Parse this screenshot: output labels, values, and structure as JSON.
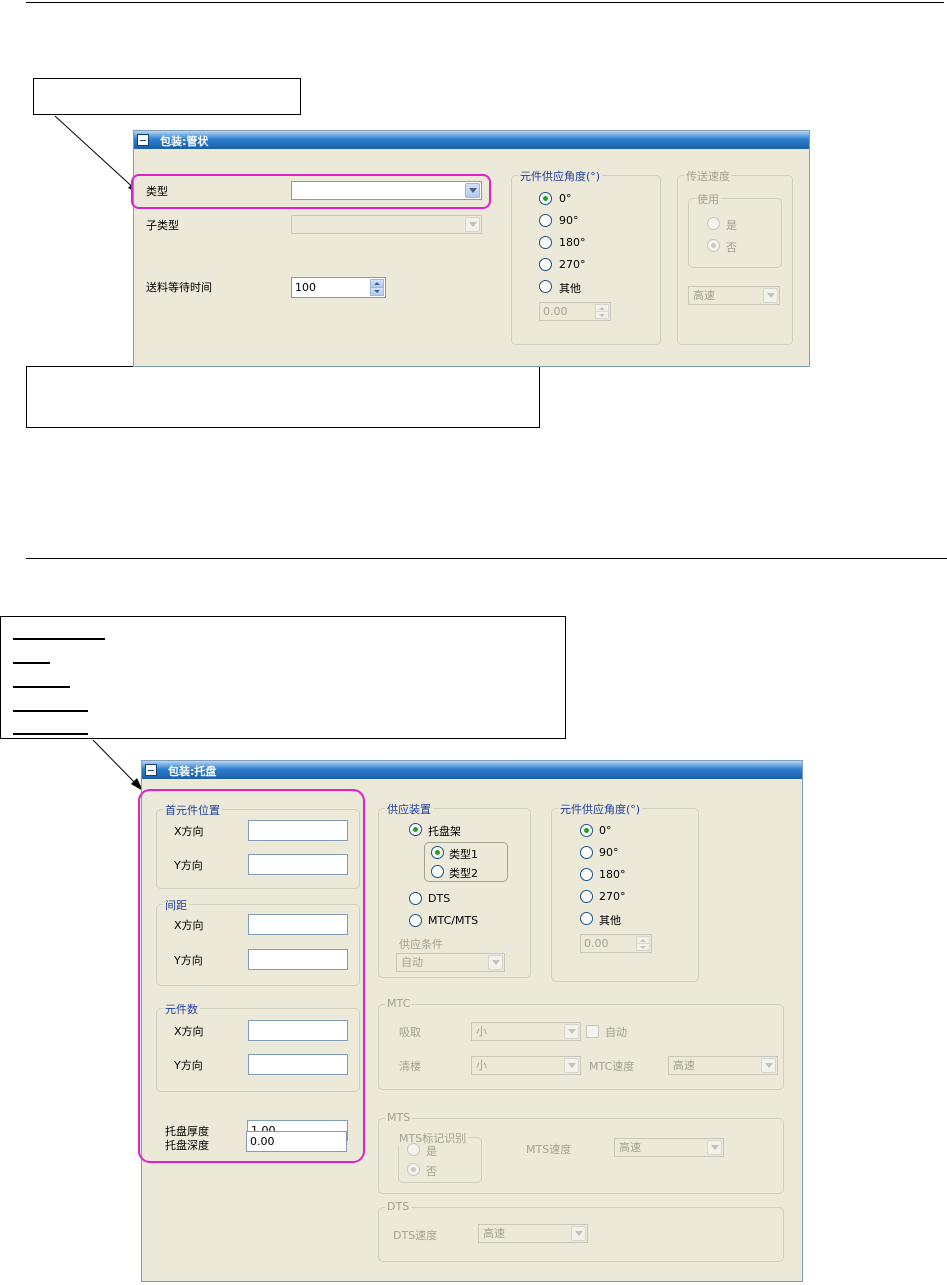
{
  "tube_panel": {
    "title": "包装:管状",
    "type_label": "类型",
    "type_value": "",
    "subtype_label": "子类型",
    "subtype_value": "",
    "feed_wait_label": "送料等待时间",
    "feed_wait_value": "100",
    "angle_group": {
      "legend": "元件供应角度(°)",
      "options": [
        "0°",
        "90°",
        "180°",
        "270°",
        "其他"
      ],
      "selected": "0°",
      "other_value": "0.00"
    },
    "speed_group": {
      "legend": "传送速度",
      "use_legend": "使用",
      "options": [
        "是",
        "否"
      ],
      "selected": "否",
      "speed_value": "高速"
    }
  },
  "tray_panel": {
    "title": "包装:托盘",
    "first_pos": {
      "legend": "首元件位置",
      "x_label": "X方向",
      "y_label": "Y方向",
      "x_value": "",
      "y_value": ""
    },
    "pitch": {
      "legend": "间距",
      "x_label": "X方向",
      "y_label": "Y方向",
      "x_value": "",
      "y_value": ""
    },
    "count": {
      "legend": "元件数",
      "x_label": "X方向",
      "y_label": "Y方向",
      "x_value": "",
      "y_value": ""
    },
    "thickness_label": "托盘厚度",
    "thickness_value": "1.00",
    "depth_label": "托盘深度",
    "depth_value": "0.00",
    "supply_device": {
      "legend": "供应装置",
      "tray_rack": "托盘架",
      "type1": "类型1",
      "type2": "类型2",
      "dts": "DTS",
      "mtc_mts": "MTC/MTS",
      "condition_label": "供应条件",
      "condition_value": "自动"
    },
    "angle_group": {
      "legend": "元件供应角度(°)",
      "options": [
        "0°",
        "90°",
        "180°",
        "270°",
        "其他"
      ],
      "selected": "0°",
      "other_value": "0.00"
    },
    "mtc": {
      "legend": "MTC",
      "pickup_label": "吸取",
      "pickup_value": "小",
      "auto_label": "自动",
      "cleanup_label": "清楼",
      "cleanup_value": "小",
      "speed_label": "MTC速度",
      "speed_value": "高速"
    },
    "mts": {
      "legend": "MTS",
      "mark_legend": "MTS标记识别",
      "yes": "是",
      "no": "否",
      "speed_label": "MTS速度",
      "speed_value": "高速"
    },
    "dts": {
      "legend": "DTS",
      "speed_label": "DTS速度",
      "speed_value": "高速"
    }
  },
  "colors": {
    "highlight": "#e020c8",
    "titlebar": "#2f7fcf",
    "panel_bg": "#ece9d8",
    "legend_text": "#1f3f9f",
    "radio_selected": "#21a121"
  }
}
